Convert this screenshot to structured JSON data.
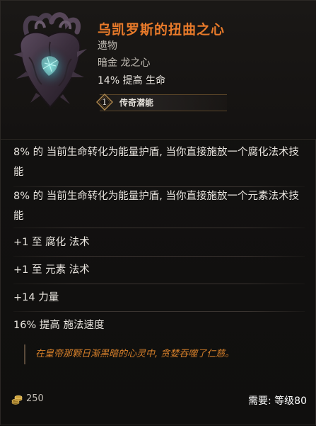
{
  "item": {
    "name": "乌凯罗斯的扭曲之心",
    "type": "遗物",
    "subtype": "暗金 龙之心",
    "implicit": "14% 提高 生命",
    "legendary_potential": {
      "value": "1",
      "label": "传奇潜能"
    }
  },
  "affixes": [
    "8% 的 当前生命转化为能量护盾, 当你直接施放一个腐化法术技能",
    "8% 的 当前生命转化为能量护盾, 当你直接施放一个元素法术技能",
    "+1 至 腐化 法术",
    "+1 至 元素 法术",
    "+14 力量",
    "16% 提高 施法速度"
  ],
  "lore": "在皇帝那颗日渐黑暗的心灵中, 贪婪吞噬了仁慈。",
  "footer": {
    "gold": "250",
    "requirement_label": "需要: 等级",
    "requirement_level": "80"
  },
  "colors": {
    "item_name": "#e87a2a",
    "lore": "#d8812a",
    "affix_text": "#e8e4de"
  },
  "icons": {
    "item": "dragon-heart-icon",
    "potential": "legendary-potential-badge-icon",
    "gold": "gold-coins-icon"
  }
}
